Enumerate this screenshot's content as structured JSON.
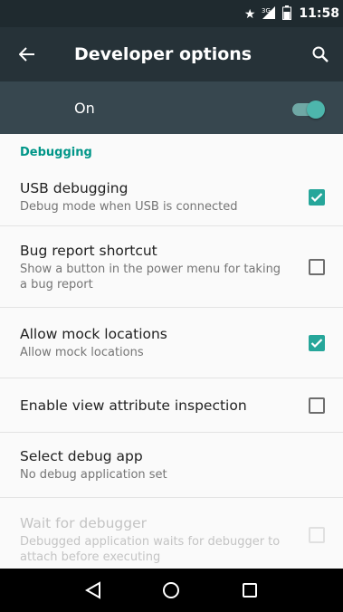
{
  "status_bar": {
    "time": "11:58",
    "icons": [
      "star-icon",
      "signal-3g-icon",
      "battery-icon"
    ],
    "network_label": "3G"
  },
  "app_bar": {
    "title": "Developer options",
    "back_icon": "arrow-back-icon",
    "search_icon": "search-icon"
  },
  "master_switch": {
    "label": "On",
    "enabled": true
  },
  "section": {
    "title": "Debugging"
  },
  "prefs": [
    {
      "title": "USB debugging",
      "summary": "Debug mode when USB is connected",
      "checked": true,
      "enabled": true
    },
    {
      "title": "Bug report shortcut",
      "summary": "Show a button in the power menu for taking a bug report",
      "checked": false,
      "enabled": true
    },
    {
      "title": "Allow mock locations",
      "summary": "Allow mock locations",
      "checked": true,
      "enabled": true
    },
    {
      "title": "Enable view attribute inspection",
      "summary": "",
      "checked": false,
      "enabled": true
    },
    {
      "title": "Select debug app",
      "summary": "No debug application set",
      "enabled": true
    },
    {
      "title": "Wait for debugger",
      "summary": "Debugged application waits for debugger to attach before executing",
      "checked": false,
      "enabled": false
    }
  ],
  "nav_bar": {
    "icons": [
      "back-triangle-icon",
      "home-circle-icon",
      "recents-square-icon"
    ]
  },
  "colors": {
    "accent": "#009688",
    "toolbar": "#263238",
    "switch_bar": "#37474f",
    "checkbox_on": "#26a69a"
  }
}
